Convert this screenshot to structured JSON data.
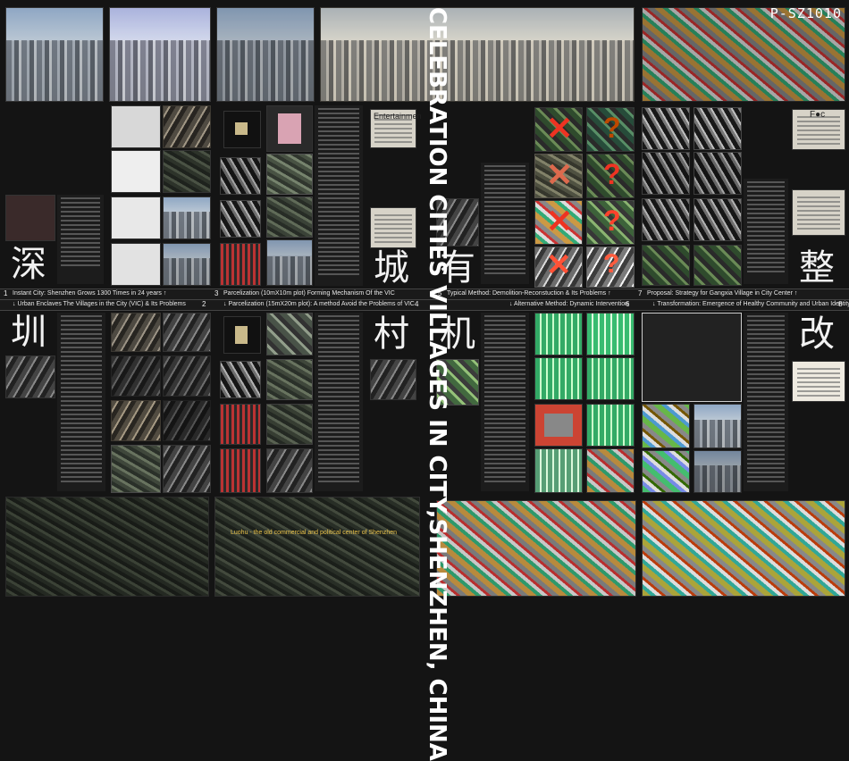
{
  "title": "CELEBRATION CITIES VILLAGES IN CITY,SHENZHEN, CHINA",
  "code": "P-SZ1010",
  "big_chars": [
    "深",
    "圳",
    "城",
    "村",
    "有",
    "机",
    "整",
    "改"
  ],
  "page_numbers": [
    "1",
    "2",
    "3",
    "4",
    "5",
    "6",
    "7",
    "8"
  ],
  "headings": {
    "h1": "Instant City: Shenzhen Grows 1300 Times in 24 years ↑",
    "h2": "↓ Urban Enclaves The Villages in the City (VIC) & Its Problems",
    "h3": "Parcelization (10mX10m plot) Forming Mechanism Of the VIC",
    "h4": "↓ Parcelization (15mX20m plot): A method  Avoid the Problems of VIC",
    "h5": "Typical Method: Demolition-Reconstuction & Its Problems ↑",
    "h6": "↓ Alternative Method: Dynamic Intervention",
    "h7": "Proposal: Strategy for Gangxia Village in City Center ↑",
    "h8": "↓ Transformation: Emergence of Healthy Community and Urban Identity"
  },
  "map_caption": "Luohu - the old commercial and political center of Shenzhen",
  "newspaper_headline": "Entertainmen",
  "newspaper_right": "F●c",
  "colors": {
    "background": "#141414",
    "accent_red": "#e33322",
    "text": "#e8e8e8"
  }
}
